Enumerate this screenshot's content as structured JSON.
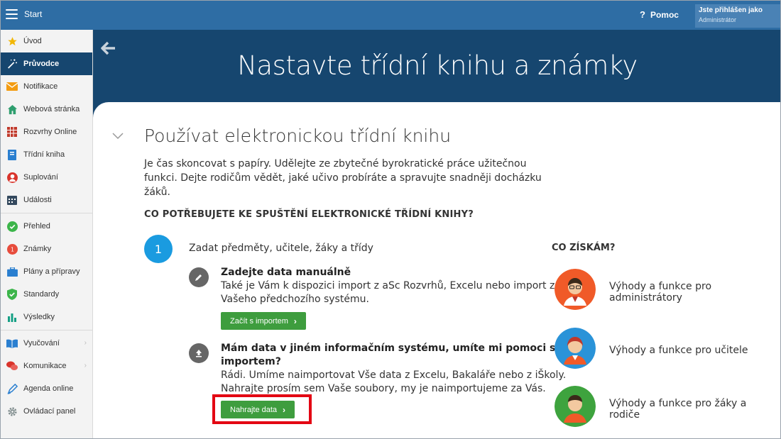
{
  "topbar": {
    "start_label": "Start",
    "help_label": "Pomoc",
    "user_line1": "Jste přihlášen jako",
    "user_line2": "Administrátor"
  },
  "sidebar": {
    "items": [
      {
        "label": "Úvod",
        "icon": "star-icon"
      },
      {
        "label": "Průvodce",
        "icon": "magic-wand-icon"
      },
      {
        "label": "Notifikace",
        "icon": "envelope-icon"
      },
      {
        "label": "Webová stránka",
        "icon": "home-icon"
      },
      {
        "label": "Rozvrhy Online",
        "icon": "calendar-grid-icon"
      },
      {
        "label": "Třídní kniha",
        "icon": "book-icon"
      },
      {
        "label": "Suplování",
        "icon": "substitute-person-icon"
      },
      {
        "label": "Události",
        "icon": "events-calendar-icon"
      },
      {
        "label": "Přehled",
        "icon": "check-circle-icon"
      },
      {
        "label": "Známky",
        "icon": "grades-icon"
      },
      {
        "label": "Plány a přípravy",
        "icon": "briefcase-icon"
      },
      {
        "label": "Standardy",
        "icon": "shield-check-icon"
      },
      {
        "label": "Výsledky",
        "icon": "bar-chart-icon"
      },
      {
        "label": "Vyučování",
        "icon": "open-book-icon"
      },
      {
        "label": "Komunikace",
        "icon": "chat-icon"
      },
      {
        "label": "Agenda online",
        "icon": "pen-icon"
      },
      {
        "label": "Ovládací panel",
        "icon": "gear-icon"
      }
    ]
  },
  "banner": {
    "title": "Nastavte třídní knihu a známky"
  },
  "section": {
    "title": "Používat elektronickou třídní knihu",
    "intro": "Je čas skoncovat s papíry. Udělejte ze zbytečné byrokratické práce užitečnou funkci. Dejte rodičům vědět, jaké učivo probíráte a spravujte snadněji docházku žáků.",
    "need_title": "CO POTŘEBUJETE KE SPUŠTĚNÍ ELEKTRONICKÉ TŘÍDNÍ KNIHY?",
    "step": {
      "number": "1",
      "label": "Zadat předměty, učitele, žáky a třídy"
    },
    "option1": {
      "title": "Zadejte data manuálně",
      "text_line1": "Také je Vám k dispozici import z aSc Rozvrhů, Excelu nebo import z",
      "text_line2": "Vašeho předchozího systému.",
      "button": "Začít s importem"
    },
    "option2": {
      "title_line1": "Mám data v jiném informačním systému, umíte mi pomoci s",
      "title_line2": "importem?",
      "text_line1": "Rádi. Umíme naimportovat Vše data z Excelu, Bakaláře nebo z iŠkoly.",
      "text_line2": "Nahrajte prosím sem Vaše soubory, my je naimportujeme za Vás.",
      "button": "Nahrajte data"
    },
    "benefits": {
      "title": "CO ZÍSKÁM?",
      "items": [
        {
          "line1": "Výhody a funkce pro",
          "line2": "administrátory",
          "color": "#f05a28"
        },
        {
          "line1": "Výhody a funkce pro učitele",
          "line2": "",
          "color": "#2a93d8"
        },
        {
          "line1": "Výhody a funkce pro žáky a",
          "line2": "rodiče",
          "color": "#3ea33e"
        }
      ]
    }
  },
  "colors": {
    "topbar": "#2e6da4",
    "banner": "#16466f",
    "sidebar_active": "#16466f",
    "step_circle": "#1a9be0",
    "button_green": "#3e9d3e",
    "highlight_red": "#e30613"
  }
}
